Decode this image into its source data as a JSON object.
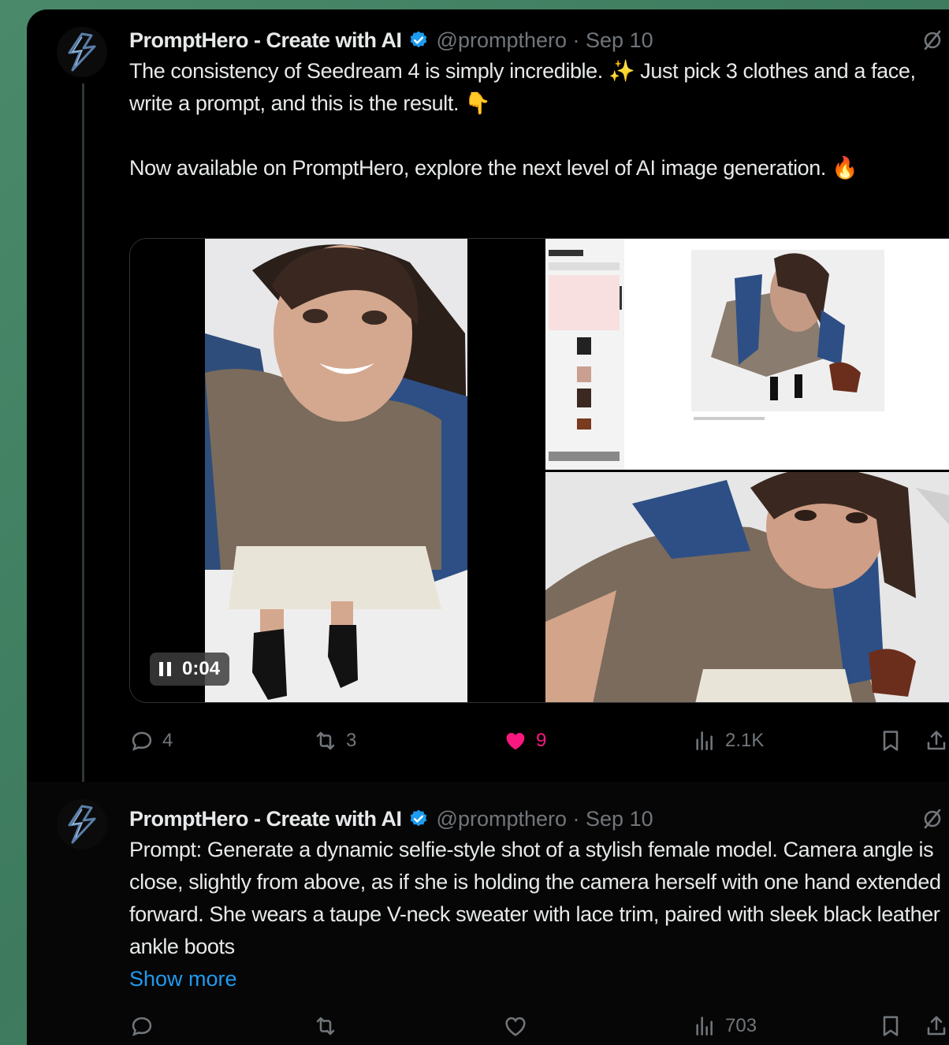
{
  "tweets": [
    {
      "author_name": "PromptHero - Create with AI",
      "handle_date": "@prompthero · Sep 10",
      "para1": "The consistency of Seedream 4 is simply incredible. ✨ Just pick 3 clothes and a face, write a prompt, and this is the result. 👇",
      "para2": "Now available on PromptHero, explore the next level of AI image generation. 🔥",
      "video_time": "0:04",
      "stats": {
        "replies": "4",
        "reposts": "3",
        "likes": "9",
        "views": "2.1K"
      }
    },
    {
      "author_name": "PromptHero - Create with AI",
      "handle_date": "@prompthero · Sep 10",
      "text": "Prompt: Generate a dynamic selfie-style shot of a stylish female model. Camera angle is close, slightly from above, as if she is holding the camera herself with one hand extended forward. She wears a taupe V-neck sweater with lace trim, paired with sleek black leather ankle boots",
      "show_more": "Show more",
      "stats": {
        "views": "703"
      }
    }
  ],
  "colors": {
    "background": "#000000",
    "text": "#e7e9ea",
    "muted": "#71767b",
    "link": "#1d9bf0",
    "like": "#f91880",
    "verified": "#1d9bf0"
  },
  "icons": [
    "lightning-logo-icon",
    "verified-badge-icon",
    "grok-icon",
    "more-icon",
    "reply-icon",
    "repost-icon",
    "like-icon",
    "views-icon",
    "bookmark-icon",
    "share-icon",
    "pause-icon"
  ]
}
